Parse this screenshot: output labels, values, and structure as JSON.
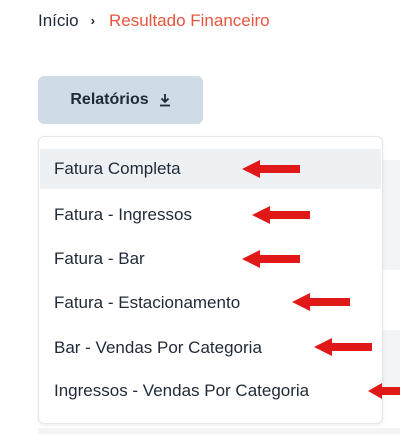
{
  "breadcrumb": {
    "home": "Início",
    "separator": "›",
    "current": "Resultado Financeiro"
  },
  "reports_button": {
    "label": "Relatórios",
    "icon": "download-icon"
  },
  "menu": {
    "items": [
      {
        "label": "Fatura Completa"
      },
      {
        "label": "Fatura - Ingressos"
      },
      {
        "label": "Fatura - Bar"
      },
      {
        "label": "Fatura - Estacionamento"
      },
      {
        "label": "Bar - Vendas Por Categoria"
      },
      {
        "label": "Ingressos - Vendas Por Categoria"
      }
    ]
  },
  "colors": {
    "accent": "#e8553d",
    "button_bg": "#cfdbe6",
    "arrow": "#e01818",
    "active_item_bg": "#eef1f4"
  }
}
